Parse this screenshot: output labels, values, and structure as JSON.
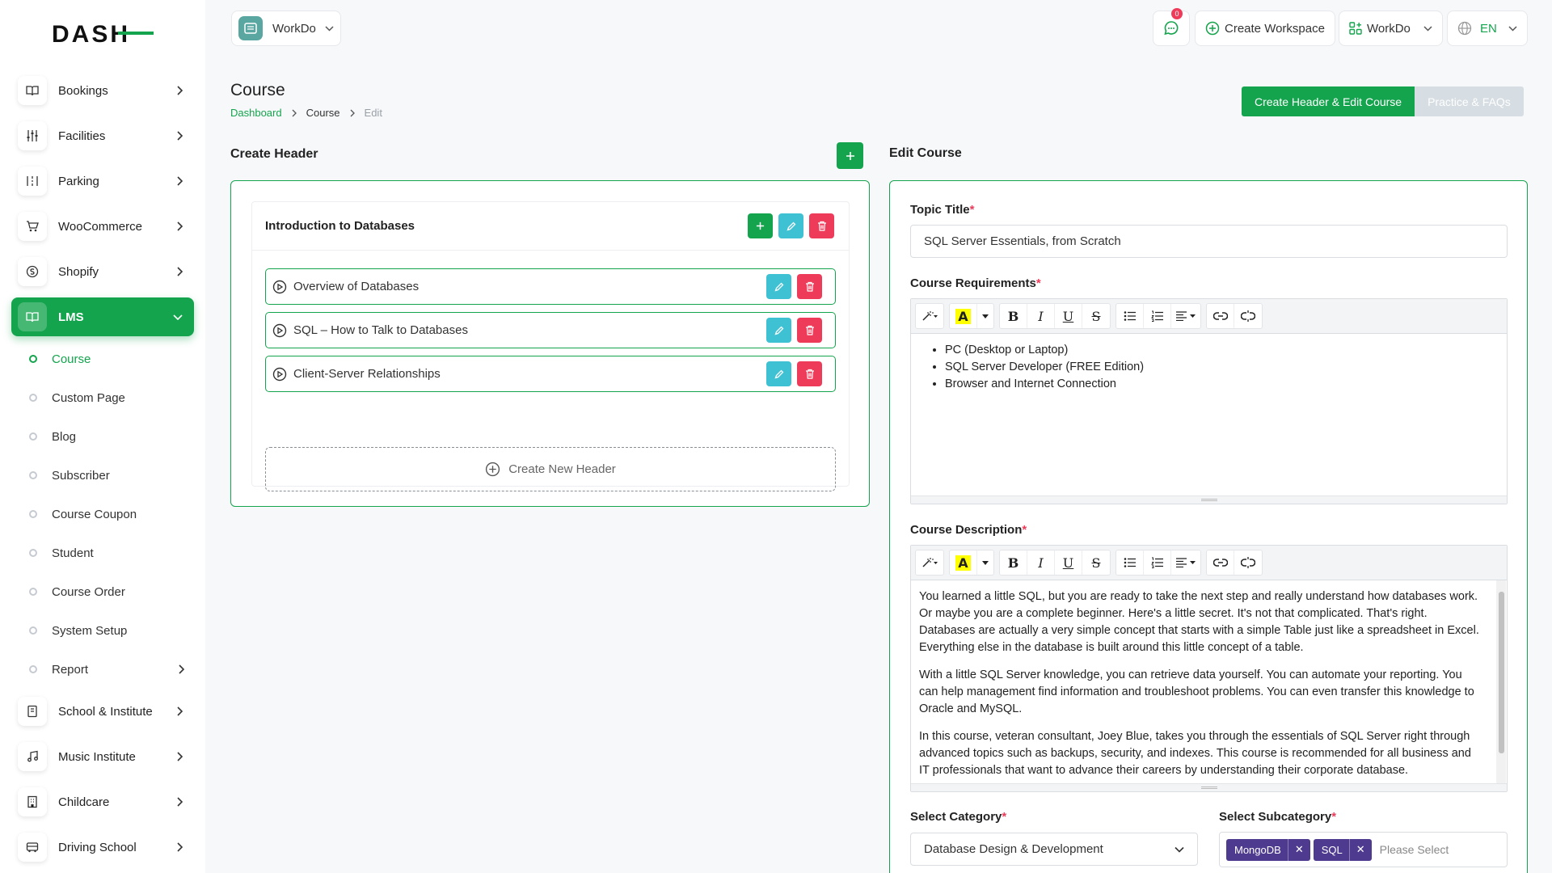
{
  "colors": {
    "primary": "#14a44d",
    "cyan": "#3ec1d3",
    "danger": "#ef3b5a",
    "chip": "#4e3a8e"
  },
  "brand": {
    "logo_text": "DASH"
  },
  "sidebar": {
    "items": [
      {
        "label": "Bookings",
        "icon": "book-open-icon"
      },
      {
        "label": "Facilities",
        "icon": "sliders-icon"
      },
      {
        "label": "Parking",
        "icon": "parking-icon"
      },
      {
        "label": "WooCommerce",
        "icon": "cart-icon"
      },
      {
        "label": "Shopify",
        "icon": "shopify-icon"
      },
      {
        "label": "LMS",
        "icon": "book-icon"
      }
    ],
    "lms_sub": [
      "Course",
      "Custom Page",
      "Blog",
      "Subscriber",
      "Course Coupon",
      "Student",
      "Course Order",
      "System Setup",
      "Report"
    ],
    "bottom_items": [
      {
        "label": "School & Institute",
        "icon": "notebook-icon"
      },
      {
        "label": "Music Institute",
        "icon": "music-icon"
      },
      {
        "label": "Childcare",
        "icon": "building-icon"
      },
      {
        "label": "Driving School",
        "icon": "bus-icon"
      }
    ]
  },
  "topbar": {
    "workspace": "WorkDo",
    "notification_count": "0",
    "create_workspace": "Create Workspace",
    "workdo_menu": "WorkDo",
    "language": "EN"
  },
  "page": {
    "title": "Course",
    "breadcrumb": [
      "Dashboard",
      "Course",
      "Edit"
    ],
    "tabs": [
      "Create Header & Edit Course",
      "Practice & FAQs"
    ]
  },
  "create_header": {
    "title": "Create Header",
    "section_title": "Introduction to Databases",
    "lessons": [
      "Overview of Databases",
      "SQL – How to Talk to Databases",
      "Client-Server Relationships"
    ],
    "new_header": "Create New Header"
  },
  "edit_course": {
    "title": "Edit Course",
    "topic_label": "Topic Title",
    "topic_value": "SQL Server Essentials, from Scratch",
    "req_label": "Course Requirements",
    "requirements": [
      "PC (Desktop or Laptop)",
      "SQL Server Developer (FREE Edition)",
      "Browser and Internet Connection"
    ],
    "desc_label": "Course Description",
    "description": [
      "You learned a little SQL, but you are ready to take the next step and really understand how databases work. Or maybe you are a complete beginner. Here's a little secret. It's not that complicated. That's right. Databases are actually a very simple concept that starts with a simple Table just like a spreadsheet in Excel. Everything else in the database is built around this little concept of a table.",
      "With a little SQL Server knowledge, you can retrieve data yourself. You can automate your reporting. You can help management find information and troubleshoot problems. You can even transfer this knowledge to Oracle and MySQL.",
      "In this course, veteran consultant, Joey Blue, takes you through the essentials of SQL Server right through advanced topics such as backups, security, and indexes. This course is recommended for all business and IT professionals that want to advance their careers by understanding their corporate database."
    ],
    "category_label": "Select Category",
    "category_value": "Database Design & Development",
    "subcategory_label": "Select Subcategory",
    "subcategory_chips": [
      "MongoDB",
      "SQL"
    ],
    "subcategory_placeholder": "Please Select"
  },
  "toolbar": {
    "bold": "B",
    "italic": "I",
    "underline": "U",
    "strike": "S",
    "highlight": "A"
  }
}
